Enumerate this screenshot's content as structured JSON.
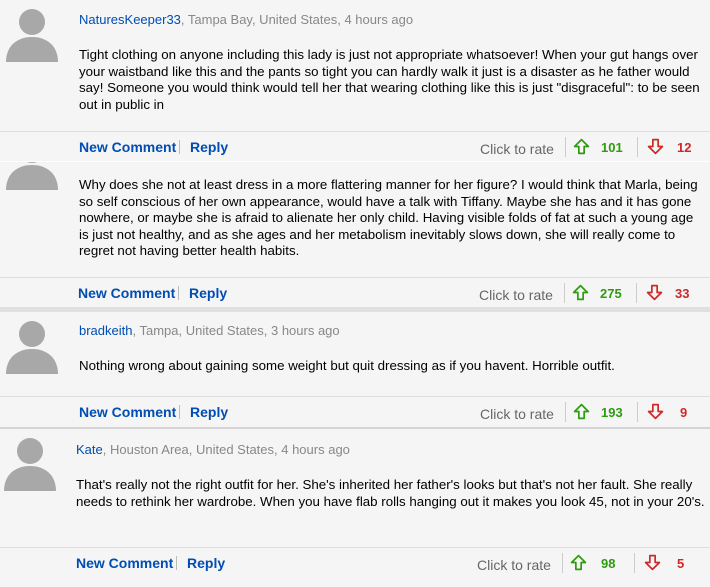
{
  "comments": [
    {
      "username": "NaturesKeeper33",
      "location_time": ", Tampa Bay, United States, 4 hours ago",
      "text": "Tight clothing on anyone including this lady is just not appropriate whatsoever! When your gut hangs over your waistband like this and the pants so tight you can hardly walk it just is a disaster as he father would say! Someone you would think would tell her that wearing clothing like this is just \"disgraceful\": to be seen out in public in",
      "new_comment_label": "New Comment",
      "reply_label": "Reply",
      "rate_label": "Click to rate",
      "up_votes": "101",
      "down_votes": "12"
    },
    {
      "text": "Why does she not at least dress in a more flattering manner for her figure? I would think that Marla, being so self conscious of her own appearance, would have a talk with Tiffany. Maybe she has and it has gone nowhere, or maybe she is afraid to alienate her only child. Having visible folds of fat at such a young age is just not healthy, and as she ages and her metabolism inevitably slows down, she will really come to regret not having better health habits.",
      "new_comment_label": "New Comment",
      "reply_label": "Reply",
      "rate_label": "Click to rate",
      "up_votes": "275",
      "down_votes": "33"
    },
    {
      "username": "bradkeith",
      "location_time": ", Tampa, United States, 3 hours ago",
      "text": "Nothing wrong about gaining some weight but quit dressing as if you havent. Horrible outfit.",
      "new_comment_label": "New Comment",
      "reply_label": "Reply",
      "rate_label": "Click to rate",
      "up_votes": "193",
      "down_votes": "9"
    },
    {
      "username": "Kate",
      "location_time": ", Houston Area, United States, 4 hours ago",
      "text": "That's really not the right outfit for her. She's inherited her father's looks but that's not her fault. She really needs to rethink her wardrobe. When you have flab rolls hanging out it makes you look 45, not in your 20's.",
      "new_comment_label": "New Comment",
      "reply_label": "Reply",
      "rate_label": "Click to rate",
      "up_votes": "98",
      "down_votes": "5"
    }
  ],
  "colors": {
    "link_blue": "#004db3",
    "upvote_green": "#2e9b11",
    "downvote_red": "#cc2929",
    "avatar_gray": "#a8a8a8",
    "background": "#f5f5f5"
  },
  "icons": {
    "avatar": "default-user-silhouette",
    "upvote": "arrow-up-outline",
    "downvote": "arrow-down-outline"
  }
}
